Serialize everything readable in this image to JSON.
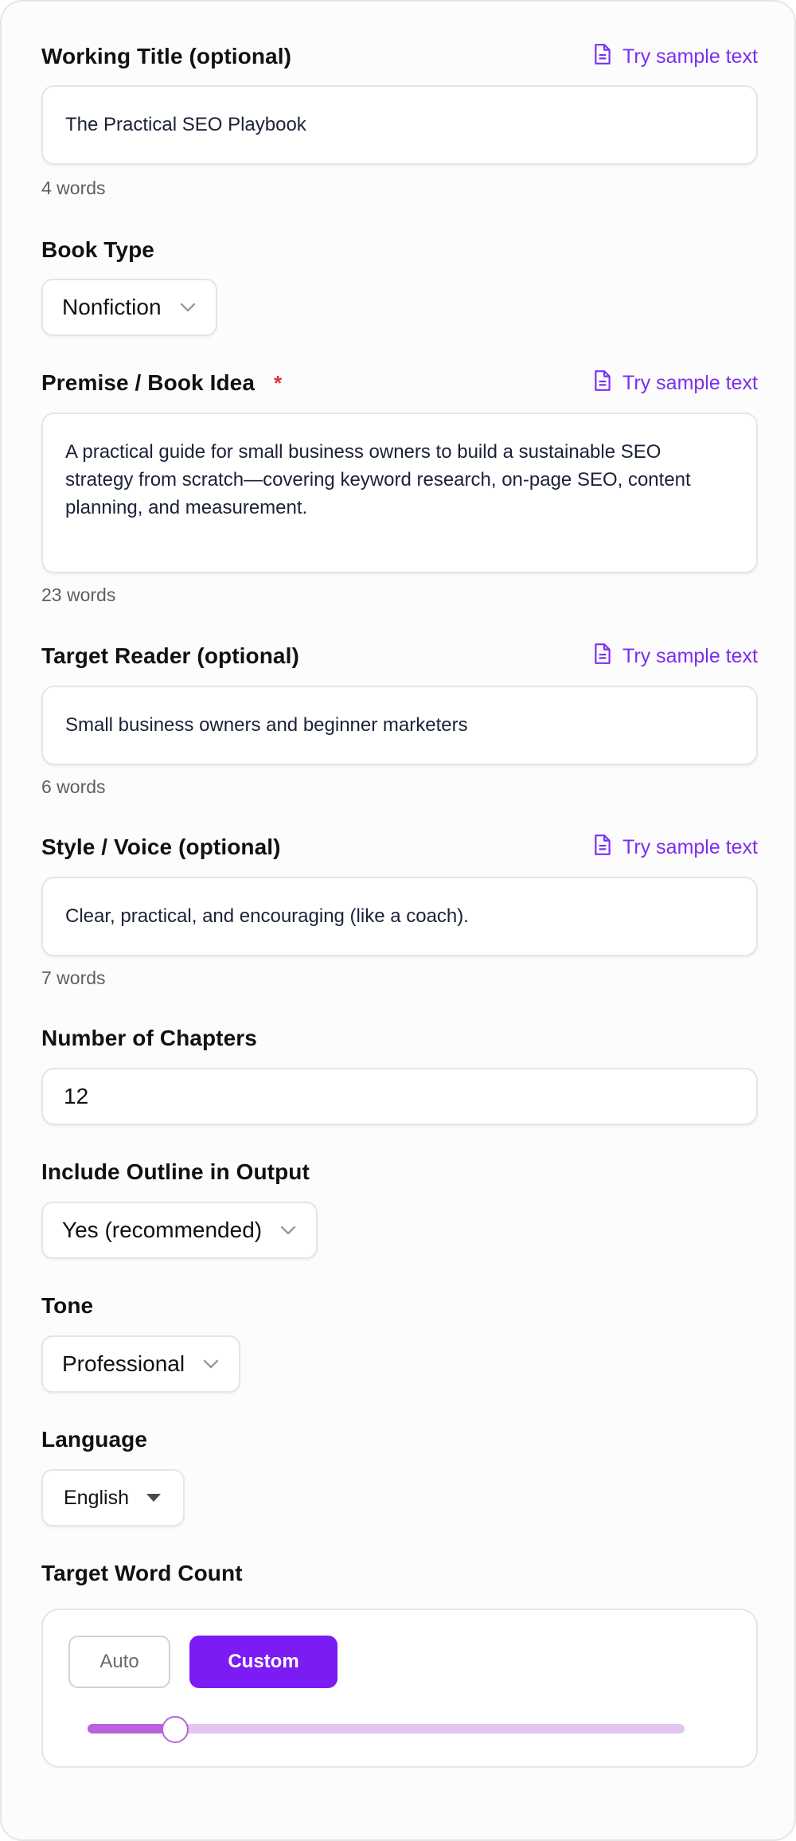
{
  "working_title": {
    "label": "Working Title (optional)",
    "sample_label": "Try sample text",
    "value": "The Practical SEO Playbook",
    "word_count": "4 words"
  },
  "book_type": {
    "label": "Book Type",
    "value": "Nonfiction"
  },
  "premise": {
    "label": "Premise / Book Idea",
    "required_mark": "*",
    "sample_label": "Try sample text",
    "value": "A practical guide for small business owners to build a sustainable SEO strategy from scratch—covering keyword research, on-page SEO, content planning, and measurement.",
    "word_count": "23 words"
  },
  "target_reader": {
    "label": "Target Reader (optional)",
    "sample_label": "Try sample text",
    "value": "Small business owners and beginner marketers",
    "word_count": "6 words"
  },
  "style_voice": {
    "label": "Style / Voice (optional)",
    "sample_label": "Try sample text",
    "value": "Clear, practical, and encouraging (like a coach).",
    "word_count": "7 words"
  },
  "chapters": {
    "label": "Number of Chapters",
    "value": "12"
  },
  "outline": {
    "label": "Include Outline in Output",
    "value": "Yes (recommended)"
  },
  "tone": {
    "label": "Tone",
    "value": "Professional"
  },
  "language": {
    "label": "Language",
    "value": "English"
  },
  "word_count_target": {
    "label": "Target Word Count",
    "auto_label": "Auto",
    "custom_label": "Custom",
    "mode": "Custom",
    "slider_fraction": 0.147
  },
  "colors": {
    "accent": "#7a1cf3",
    "link": "#7b2ff0",
    "required": "#e0313e",
    "slider_fill": "#b862dc",
    "slider_track": "#e2c5f1"
  },
  "icons": {
    "sample": "document-icon",
    "dropdown": "chevron-down-icon",
    "language_dropdown": "caret-down-icon"
  }
}
